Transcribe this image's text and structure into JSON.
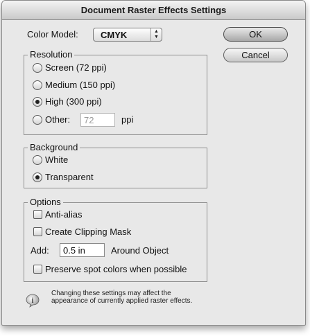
{
  "window": {
    "title": "Document Raster Effects Settings"
  },
  "color_model": {
    "label": "Color Model:",
    "value": "CMYK"
  },
  "buttons": {
    "ok": "OK",
    "cancel": "Cancel"
  },
  "resolution": {
    "title": "Resolution",
    "options": [
      "Screen (72 ppi)",
      "Medium (150 ppi)",
      "High (300 ppi)",
      "Other:"
    ],
    "selected": "High (300 ppi)",
    "other_value": "72",
    "other_unit": "ppi"
  },
  "background": {
    "title": "Background",
    "options": [
      "White",
      "Transparent"
    ],
    "selected": "Transparent"
  },
  "options": {
    "title": "Options",
    "anti_alias": "Anti-alias",
    "clipping_mask": "Create Clipping Mask",
    "add_label": "Add:",
    "add_value": "0.5 in",
    "around_object": "Around Object",
    "preserve_spot": "Preserve spot colors when possible"
  },
  "info": {
    "icon": "info-icon",
    "text": "Changing these settings may affect the appearance of currently applied raster effects."
  }
}
